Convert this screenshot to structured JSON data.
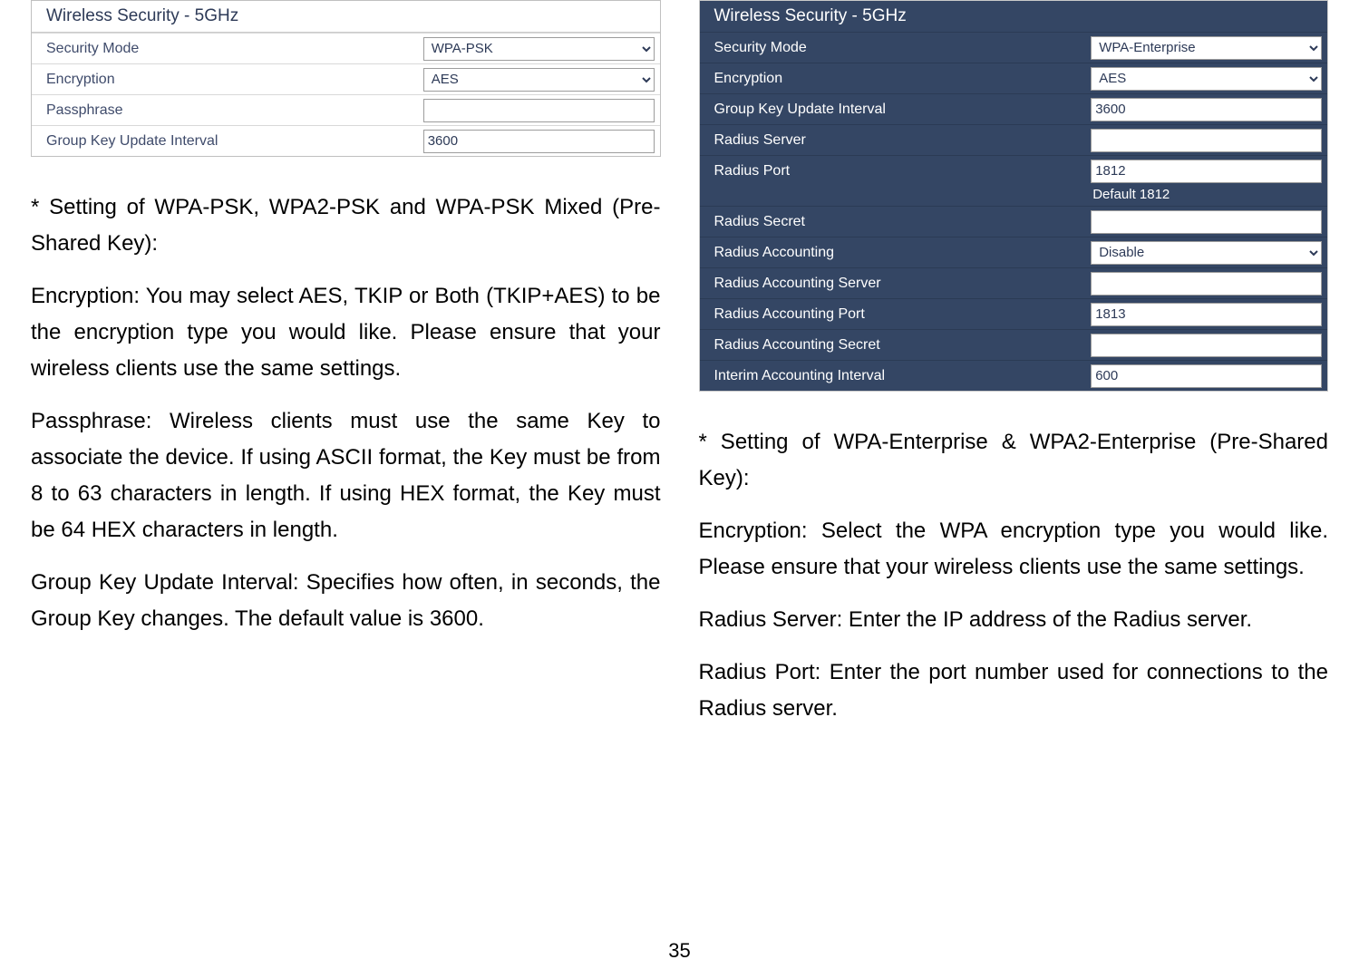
{
  "left_panel": {
    "title": "Wireless Security - 5GHz",
    "rows": [
      {
        "label": "Security Mode",
        "type": "select",
        "value": "WPA-PSK"
      },
      {
        "label": "Encryption",
        "type": "select",
        "value": "AES"
      },
      {
        "label": "Passphrase",
        "type": "text",
        "value": ""
      },
      {
        "label": "Group Key Update Interval",
        "type": "text",
        "value": "3600"
      }
    ]
  },
  "right_panel": {
    "title": "Wireless Security - 5GHz",
    "rows": [
      {
        "label": "Security Mode",
        "type": "select",
        "value": "WPA-Enterprise"
      },
      {
        "label": "Encryption",
        "type": "select",
        "value": "AES"
      },
      {
        "label": "Group Key Update Interval",
        "type": "text",
        "value": "3600"
      },
      {
        "label": "Radius Server",
        "type": "text",
        "value": ""
      },
      {
        "label": "Radius Port",
        "type": "text",
        "value": "1812",
        "hint": "Default 1812"
      },
      {
        "label": "Radius Secret",
        "type": "text",
        "value": ""
      },
      {
        "label": "Radius Accounting",
        "type": "select",
        "value": "Disable"
      },
      {
        "label": "Radius Accounting Server",
        "type": "text",
        "value": "",
        "disabled": true
      },
      {
        "label": "Radius Accounting Port",
        "type": "text",
        "value": "1813",
        "disabled": true
      },
      {
        "label": "Radius Accounting Secret",
        "type": "text",
        "value": "",
        "disabled": true
      },
      {
        "label": "Interim Accounting Interval",
        "type": "text",
        "value": "600",
        "disabled": true
      }
    ]
  },
  "left_text": {
    "p1": "* Setting of WPA-PSK, WPA2-PSK and WPA-PSK Mixed (Pre-Shared Key):",
    "p2": "Encryption: You may select AES, TKIP or Both (TKIP+AES) to be the encryption type you would like. Please ensure that your wireless clients use the same settings.",
    "p3": "Passphrase: Wireless clients must use the same Key to associate the device. If using ASCII format, the Key must be from 8 to 63 characters in length. If using HEX format, the Key must be 64 HEX characters in length.",
    "p4": "Group Key Update Interval: Specifies how often, in seconds, the Group Key changes. The default value is 3600."
  },
  "right_text": {
    "p1": "* Setting of WPA-Enterprise & WPA2-Enterprise (Pre-Shared Key):",
    "p2": "Encryption: Select the WPA encryption type you would like. Please ensure that your wireless clients use the same settings.",
    "p3": "Radius Server: Enter the IP address of the Radius server.",
    "p4": "Radius Port: Enter the port number used for connections to the Radius server."
  },
  "page_number": "35"
}
